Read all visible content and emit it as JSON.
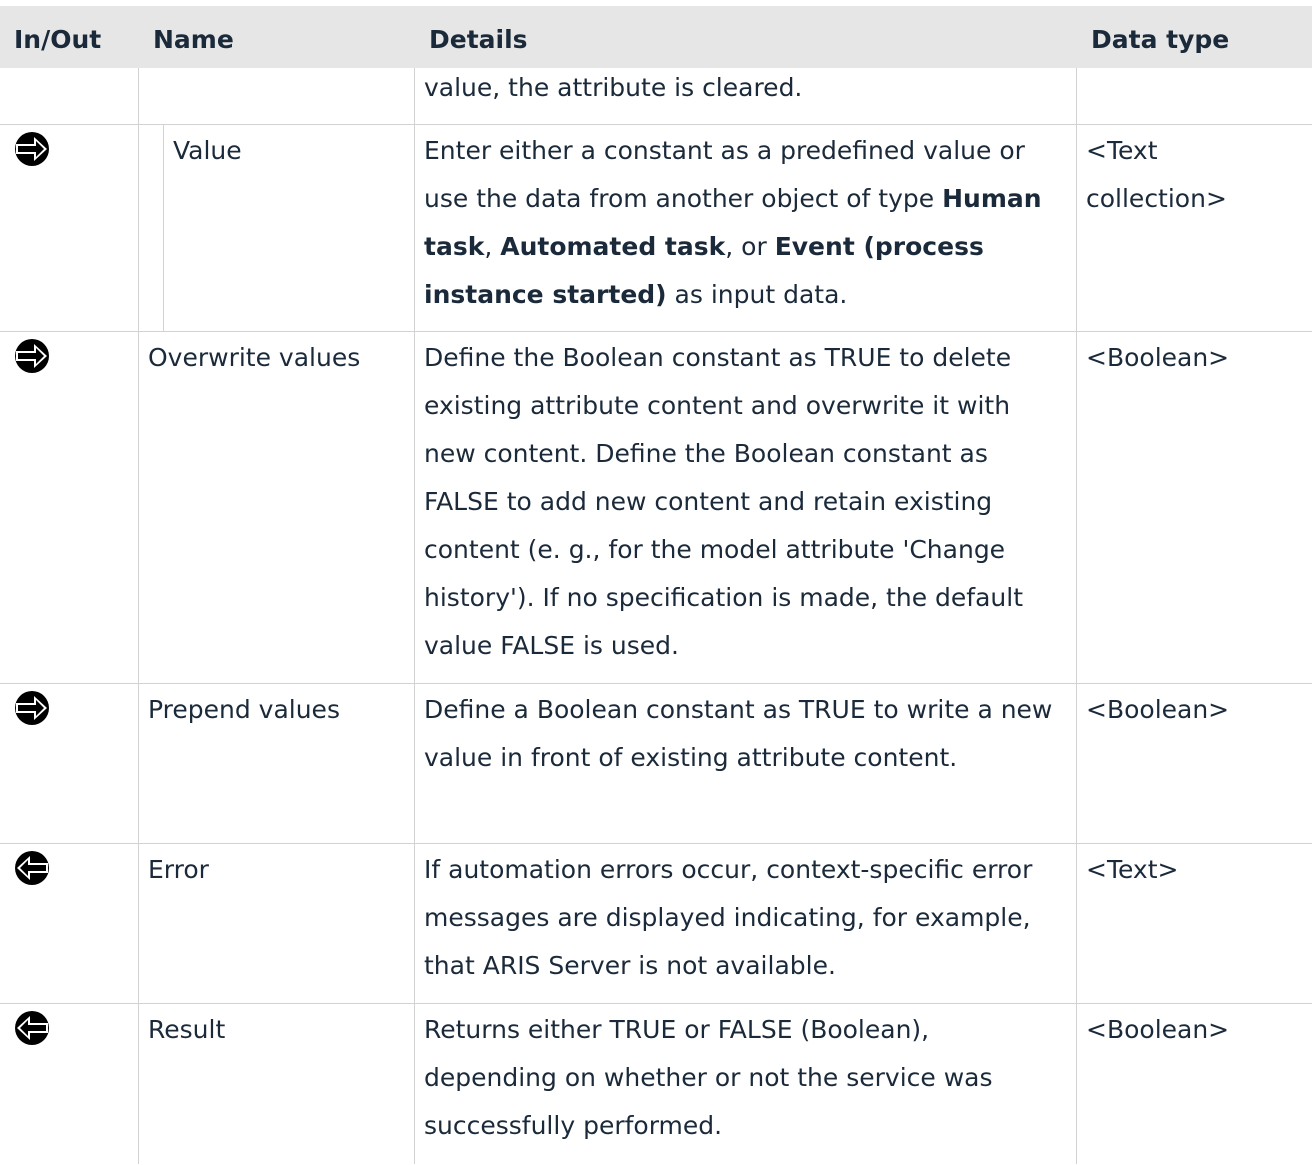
{
  "header": {
    "in_out": "In/Out",
    "name": "Name",
    "details": "Details",
    "data_type": "Data type"
  },
  "rows": [
    {
      "direction": "",
      "name": "",
      "details": "value, the attribute is cleared.",
      "data_type": ""
    },
    {
      "direction": "input-arrow-icon",
      "name": "Value",
      "details_parts": [
        "Enter either a constant as a predefined value or use the data from another object of type ",
        "Human task",
        ", ",
        "Automated task",
        ", or ",
        "Event (process instance started)",
        " as input data."
      ],
      "data_type": "<Text collection>"
    },
    {
      "direction": "input-arrow-icon",
      "name": "Overwrite values",
      "details": "Define the Boolean constant as TRUE to delete existing attribute content and overwrite it with new content. Define the Boolean constant as FALSE to add new content and retain existing content (e. g., for the model attribute 'Change history'). If no specification is made, the default value FALSE is used.",
      "data_type": "<Boolean>"
    },
    {
      "direction": "input-arrow-icon",
      "name": "Prepend values",
      "details": "Define a Boolean constant as TRUE to write a new value in front of existing attribute content.",
      "data_type": "<Boolean>"
    },
    {
      "direction": "output-arrow-icon",
      "name": "Error",
      "details": "If automation errors occur, context-specific error messages are displayed indicating, for example, that ARIS Server is not available.",
      "data_type": "<Text>"
    },
    {
      "direction": "output-arrow-icon",
      "name": "Result",
      "details": "Returns either TRUE or FALSE (Boolean), depending on whether or not the service was successfully performed.",
      "data_type": "<Boolean>"
    }
  ],
  "colors": {
    "header_bg": "#e6e6e6",
    "text": "#1b2a3a",
    "grid": "#d2d2d2"
  }
}
